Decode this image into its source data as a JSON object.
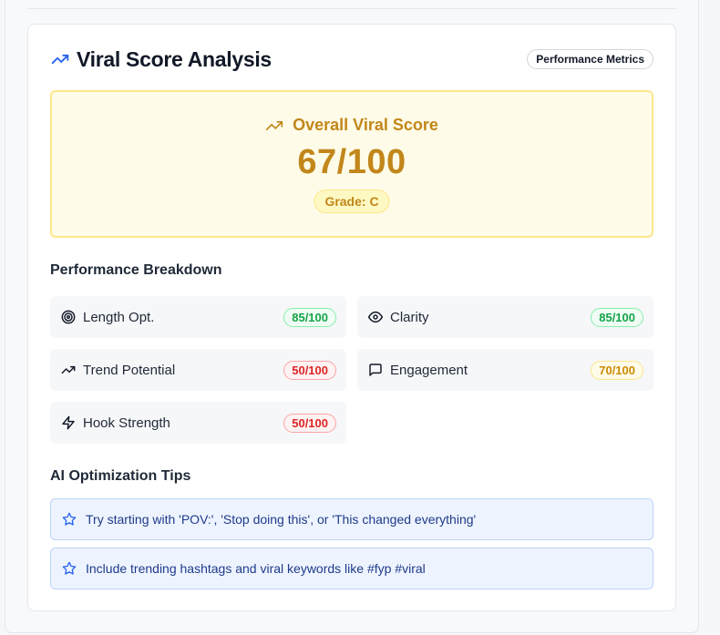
{
  "card": {
    "title": "Viral Score Analysis",
    "badge": "Performance Metrics"
  },
  "overall": {
    "label": "Overall Viral Score",
    "score": "67/100",
    "grade": "Grade: C"
  },
  "breakdown": {
    "title": "Performance Breakdown",
    "metrics": [
      {
        "label": "Length Opt.",
        "score": "85/100",
        "icon": "target-icon",
        "status": "green"
      },
      {
        "label": "Clarity",
        "score": "85/100",
        "icon": "eye-icon",
        "status": "green"
      },
      {
        "label": "Trend Potential",
        "score": "50/100",
        "icon": "trending-up-icon",
        "status": "red"
      },
      {
        "label": "Engagement",
        "score": "70/100",
        "icon": "message-square-icon",
        "status": "yellow"
      },
      {
        "label": "Hook Strength",
        "score": "50/100",
        "icon": "zap-icon",
        "status": "red"
      }
    ]
  },
  "tips": {
    "title": "AI Optimization Tips",
    "items": [
      {
        "text": "Try starting with 'POV:', 'Stop doing this', or 'This changed everything'",
        "icon": "star-icon"
      },
      {
        "text": "Include trending hashtags and viral keywords like #fyp #viral",
        "icon": "star-icon"
      }
    ]
  },
  "colors": {
    "accent_blue": "#2563eb",
    "score_gold": "#c2861a",
    "green": "#16a34a",
    "red": "#dc2626",
    "yellow": "#ca8a04",
    "tip_background": "#eef4ff"
  }
}
